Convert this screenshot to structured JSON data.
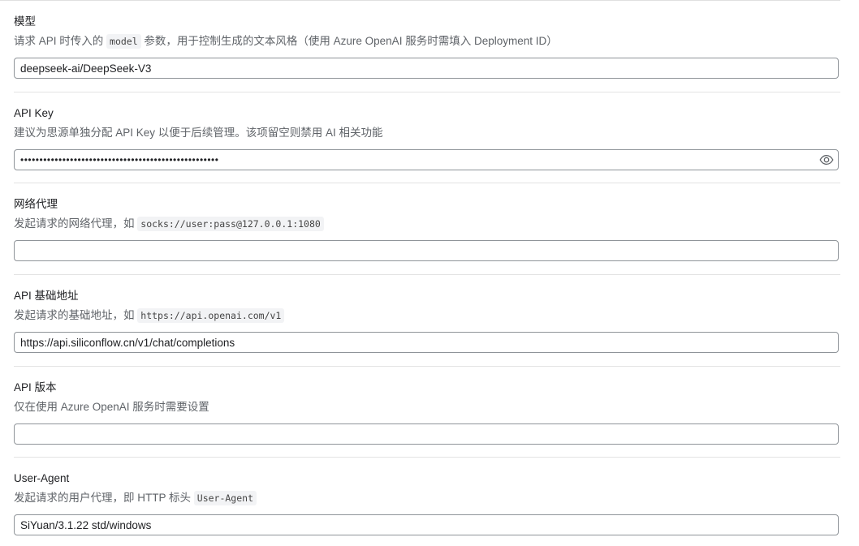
{
  "model": {
    "title": "模型",
    "desc_pre": "请求 API 时传入的 ",
    "desc_code": "model",
    "desc_post": " 参数，用于控制生成的文本风格（使用 Azure OpenAI 服务时需填入 Deployment ID）",
    "value": "deepseek-ai/DeepSeek-V3"
  },
  "api_key": {
    "title": "API Key",
    "desc": "建议为思源单独分配 API Key 以便于后续管理。该项留空则禁用 AI 相关功能",
    "value": "••••••••••••••••••••••••••••••••••••••••••••••••••••",
    "reveal_icon": "eye-icon"
  },
  "proxy": {
    "title": "网络代理",
    "desc_pre": "发起请求的网络代理，如 ",
    "desc_code": "socks://user:pass@127.0.0.1:1080",
    "value": ""
  },
  "base_url": {
    "title": "API 基础地址",
    "desc_pre": "发起请求的基础地址，如 ",
    "desc_code": "https://api.openai.com/v1",
    "value": "https://api.siliconflow.cn/v1/chat/completions"
  },
  "api_version": {
    "title": "API 版本",
    "desc": "仅在使用 Azure OpenAI 服务时需要设置",
    "value": ""
  },
  "user_agent": {
    "title": "User-Agent",
    "desc_pre": "发起请求的用户代理，即 HTTP 标头 ",
    "desc_code": "User-Agent",
    "value": "SiYuan/3.1.22 std/windows"
  }
}
